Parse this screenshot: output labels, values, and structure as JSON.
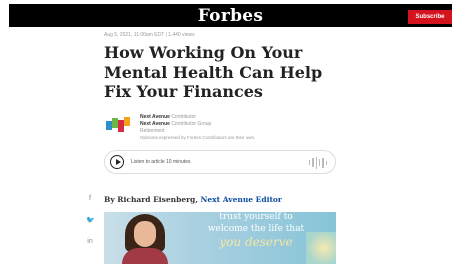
{
  "header": {
    "logo": "Forbes",
    "subscribe_label": "Subscribe"
  },
  "article": {
    "meta": "Aug 5, 2021, 11:00am EDT  |  1,440 views",
    "title": "How Working On Your Mental Health Can Help Fix Your Finances",
    "byline": {
      "name": "Next Avenue",
      "role": "Contributor",
      "name2": "Next Avenue",
      "role2": "Contributor Group",
      "section": "Retirement",
      "note": "Opinions expressed by Forbes Contributors are their own."
    },
    "audio": {
      "label": "Listen to article  10 minutes"
    },
    "author_prefix": "By Richard Eisenberg,",
    "author_role": "Next Avenue Editor",
    "image_text": {
      "line1": "trust yourself to",
      "line2": "welcome the life that",
      "line3": "you deserve"
    }
  },
  "social": {
    "facebook": "f",
    "twitter": "🐦",
    "linkedin": "in"
  }
}
